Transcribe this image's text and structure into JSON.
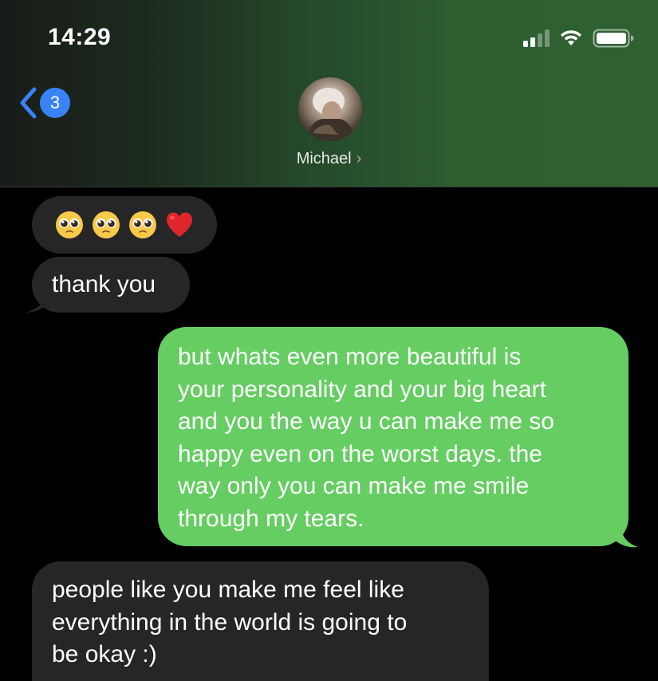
{
  "status_bar": {
    "time": "14:29"
  },
  "nav": {
    "unread_count": "3",
    "contact_name": "Michael",
    "contact_chevron": "›"
  },
  "messages": [
    {
      "direction": "incoming",
      "type": "emoji",
      "emojis": [
        "pleading-face",
        "pleading-face",
        "pleading-face",
        "red-heart"
      ]
    },
    {
      "direction": "incoming",
      "text": "thank you"
    },
    {
      "direction": "outgoing",
      "lines": [
        "but whats even more beautiful is",
        "your personality and your big heart",
        "and you the way u can make me so",
        "happy even on the worst days. the",
        "way only you can make me smile",
        "through my tears."
      ]
    },
    {
      "direction": "incoming",
      "lines": [
        "people like you make me feel like",
        "everything in the world is going to",
        "be okay :)"
      ]
    }
  ],
  "colors": {
    "incoming_bubble": "#262628",
    "outgoing_bubble": "#65cd62",
    "badge": "#3a82f7",
    "back_chevron": "#3a82f7"
  },
  "icons": {
    "signal": "cellular-signal-icon",
    "wifi": "wifi-icon",
    "battery": "battery-icon",
    "back": "back-chevron-icon"
  }
}
